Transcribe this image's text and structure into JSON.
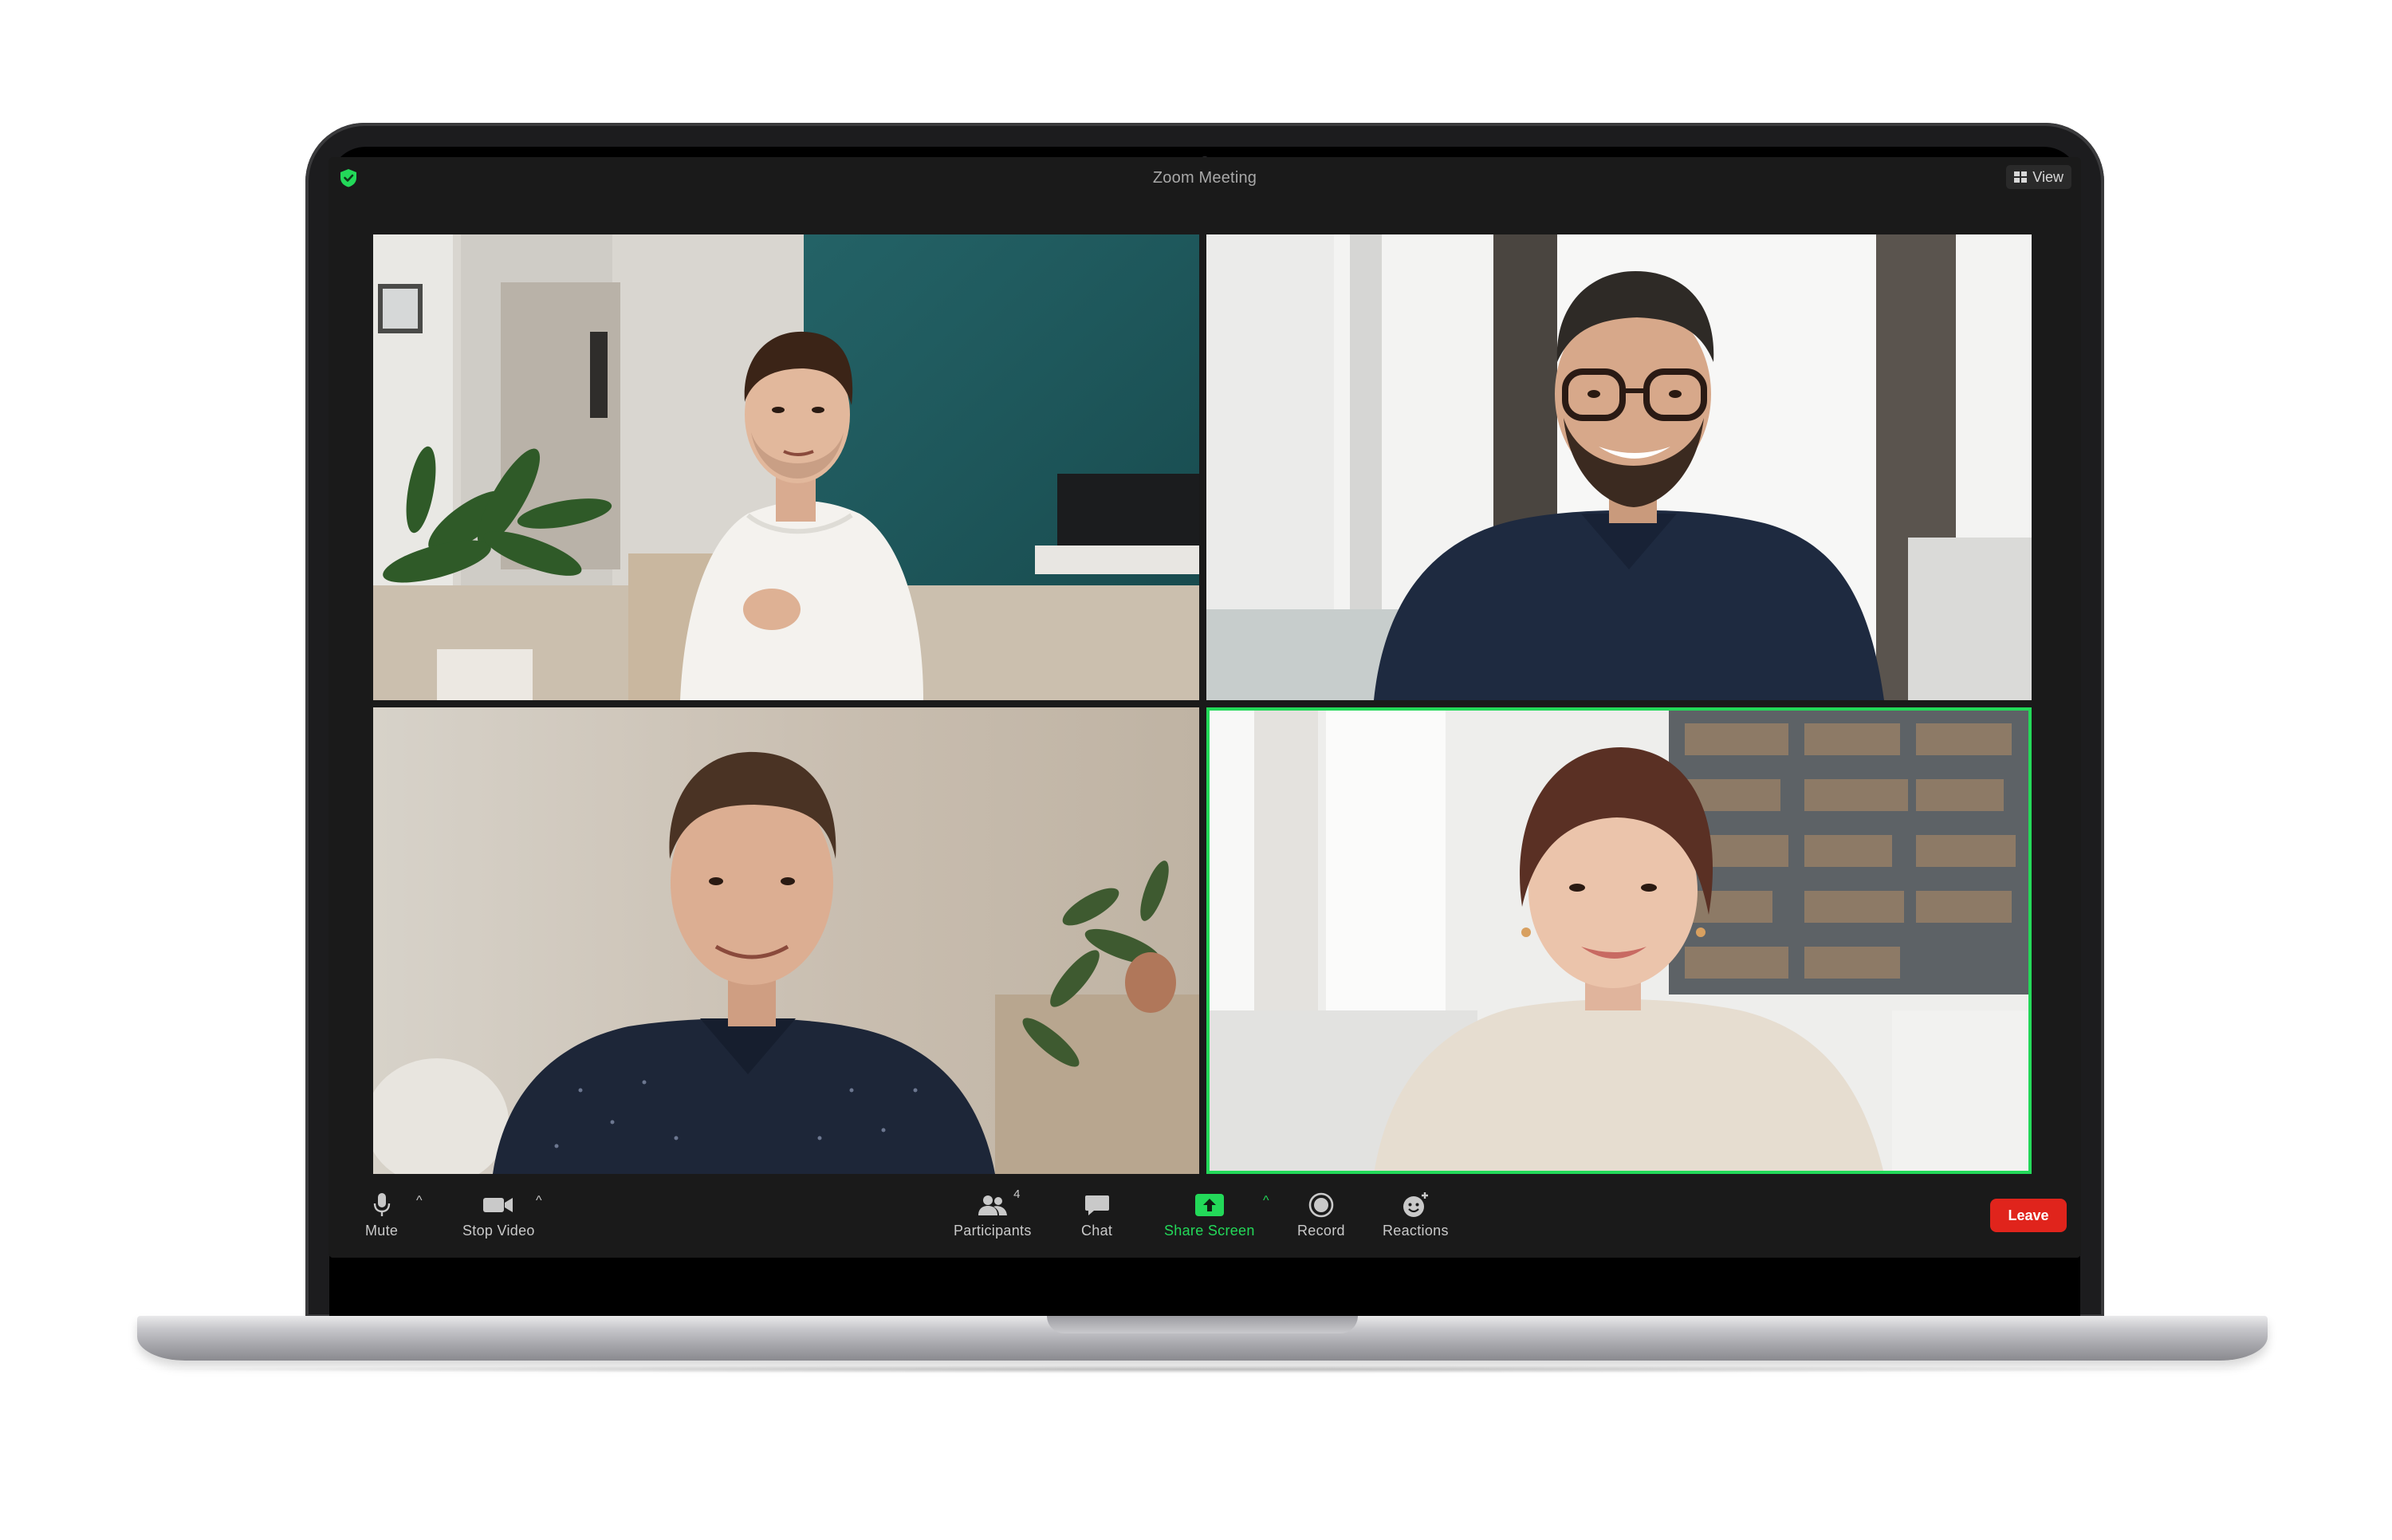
{
  "window": {
    "title": "Zoom Meeting",
    "view_label": "View",
    "accent_green": "#23d959",
    "leave_red": "#e0241c"
  },
  "video_tiles": [
    {
      "description_icon": "participant-video",
      "active_speaker": false
    },
    {
      "description_icon": "participant-video",
      "active_speaker": false
    },
    {
      "description_icon": "participant-video",
      "active_speaker": false
    },
    {
      "description_icon": "participant-video",
      "active_speaker": true
    }
  ],
  "toolbar": {
    "mute_label": "Mute",
    "stop_video_label": "Stop Video",
    "participants_label": "Participants",
    "participants_count": "4",
    "chat_label": "Chat",
    "share_screen_label": "Share Screen",
    "record_label": "Record",
    "reactions_label": "Reactions",
    "leave_label": "Leave"
  }
}
